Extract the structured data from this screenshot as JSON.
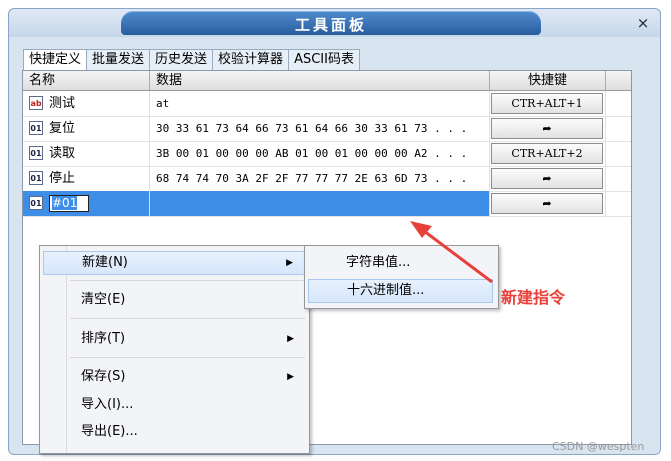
{
  "window": {
    "title": "工具面板",
    "close": "×"
  },
  "tabs": [
    {
      "label": "快捷定义",
      "active": true
    },
    {
      "label": "批量发送",
      "active": false
    },
    {
      "label": "历史发送",
      "active": false
    },
    {
      "label": "校验计算器",
      "active": false
    },
    {
      "label": "ASCII码表",
      "active": false
    }
  ],
  "table": {
    "headers": {
      "name": "名称",
      "data": "数据",
      "key": "快捷键"
    },
    "rows": [
      {
        "icon": "ab",
        "name": "测试",
        "data": "at",
        "key": "CTR+ALT+1"
      },
      {
        "icon": "hex",
        "name": "复位",
        "data": "30 33 61 73 64 66 73 61 64 66 30 33 61 73 . . .",
        "key": "➦"
      },
      {
        "icon": "hex",
        "name": "读取",
        "data": "3B 00 01 00 00 00 AB 01 00 01 00 00 00 A2 . . .",
        "key": "CTR+ALT+2"
      },
      {
        "icon": "hex",
        "name": "停止",
        "data": "68 74 74 70 3A 2F 2F 77 77 77 2E 63 6D 73 . . .",
        "key": "➦"
      },
      {
        "icon": "hex",
        "name": "#01",
        "data": "",
        "key": "➦"
      }
    ]
  },
  "context_menu": {
    "new": "新建(N)",
    "clear": "清空(E)",
    "sort": "排序(T)",
    "save": "保存(S)",
    "import": "导入(I)...",
    "export": "导出(E)..."
  },
  "submenu": {
    "string": "字符串值...",
    "hex": "十六进制值..."
  },
  "annotation": "新建指令",
  "watermark": "CSDN @wespten",
  "colors": {
    "selection": "#3e8ee8",
    "annotation": "#e8403a",
    "title_bar": "#2a5e9d"
  }
}
